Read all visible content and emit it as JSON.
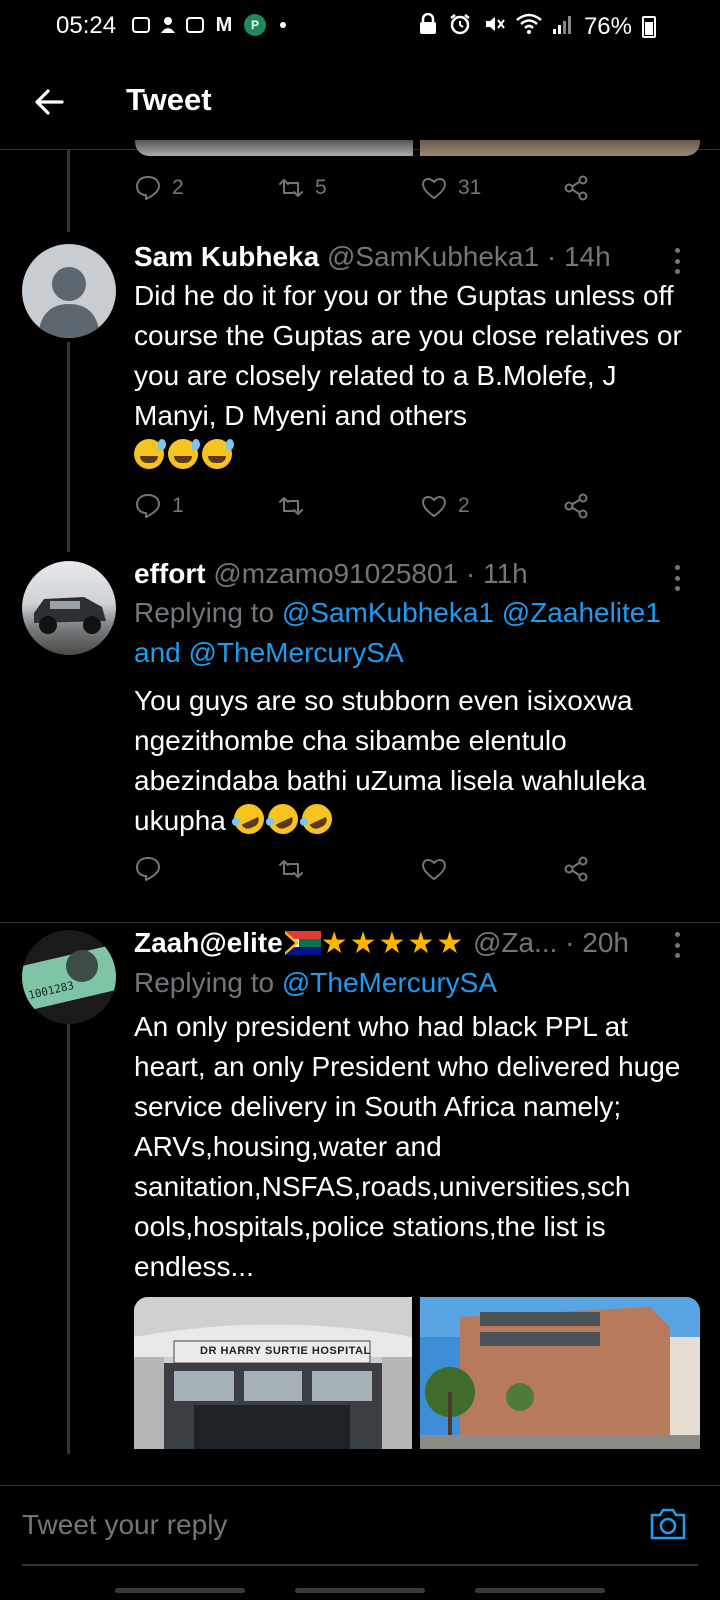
{
  "status_bar": {
    "time": "05:24",
    "mail_glyph": "M",
    "green_app_glyph": "P",
    "battery": "76%"
  },
  "header": {
    "title": "Tweet"
  },
  "parent_tweet_actions": {
    "replies": "2",
    "retweets": "5",
    "likes": "31"
  },
  "tweets": [
    {
      "name": "Sam Kubheka",
      "meta": "@SamKubheka1 · 14h",
      "text": "Did he do it for you or the Guptas unless off course the Guptas are you close relatives or you are closely related to a B.Molefe, J Manyi, D Myeni and others",
      "replies": "1",
      "retweets": "",
      "likes": "2"
    },
    {
      "name": "effort",
      "meta": "@mzamo91025801 · 11h",
      "replying_prefix": "Replying to ",
      "mention1": "@SamKubheka1",
      "mention2": "@Zaahelite1",
      "and_word": "and ",
      "mention3": "@TheMercurySA",
      "text": "You guys are so stubborn even isixoxwa ngezithombe cha sibambe elentulo abezindaba bathi uZuma lisela wahluleka ukupha",
      "replies": "",
      "retweets": "",
      "likes": ""
    },
    {
      "name": "Zaah@elite",
      "handle": "@Za...",
      "time": "· 20h",
      "stars": "★★★★★",
      "replying_prefix": "Replying to ",
      "mention1": "@TheMercurySA",
      "text": "An only president who had black PPL at heart, an only President who delivered huge service delivery in South Africa namely; ARVs,housing,water and sanitation,NSFAS,roads,universities,sch ools,hospitals,police stations,the list is endless...",
      "image1_sign": "DR HARRY SURTIE HOSPITAL",
      "avatar_text": "1001283"
    }
  ],
  "reply_bar": {
    "placeholder": "Tweet your reply"
  },
  "colors": {
    "background": "#000000",
    "link": "#1d9bf0",
    "muted": "#71767b",
    "star": "#ffb400"
  }
}
